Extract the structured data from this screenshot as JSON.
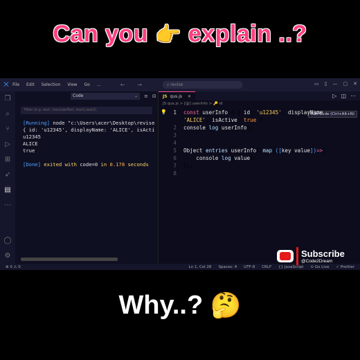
{
  "overlay": {
    "headline": "Can you",
    "headline_emoji": "👉",
    "headline_rest": "explain ..?",
    "footer": "Why..?",
    "footer_emoji": "🤔",
    "subscribe": "Subscribe",
    "channel": "@Code2Dream"
  },
  "window": {
    "menu": [
      "File",
      "Edit",
      "Selection",
      "View",
      "Go",
      "..."
    ],
    "search": "revise"
  },
  "panel": {
    "dropdown": "Code",
    "filter_placeholder": "Filter (e.g. text, !excludeText, text1,text2)",
    "output": {
      "running": "[Running]",
      "command": " node \"c:\\Users\\acer\\Desktop\\revise",
      "line2": "{ id: 'u12345', displayName: 'ALICE', isActi",
      "line3": "u12345",
      "line4": "ALICE",
      "line5": "true",
      "done": "[Done]",
      "done_text1": " exited with ",
      "done_code": "code=0",
      "done_text2": " in ",
      "done_time": "0.178",
      "done_text3": " seconds"
    }
  },
  "editor": {
    "tab": "qus.js",
    "tab_icon": "JS",
    "breadcrumb": "JS qus.js > [@] userInfo > 🔑 id",
    "tooltip": "Run Code (Ctrl+Alt+N)",
    "line_numbers": [
      "1",
      "",
      "2",
      "3",
      "4",
      "5",
      "6",
      "7",
      "8"
    ]
  },
  "statusbar": {
    "left": "⊗ 0 ⚠ 0",
    "position": "Ln 1, Col 28",
    "spaces": "Spaces: 4",
    "encoding": "UTF-8",
    "eol": "CRLF",
    "lang": "{} JavaScript",
    "golive": "⊙ Go Live",
    "prettier": "✓ Prettier"
  }
}
